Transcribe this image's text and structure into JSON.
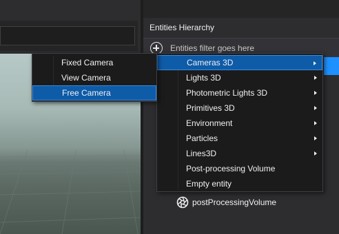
{
  "viewport_panel": {},
  "hierarchy": {
    "title": "Entities Hierarchy",
    "filter_placeholder": "Entities filter goes here",
    "add_icon": "plus-circle-icon",
    "items": [
      {
        "label": "postProcessingVolume",
        "icon": "aperture-icon"
      }
    ]
  },
  "context_menu": {
    "items": [
      {
        "label": "Cameras 3D",
        "has_submenu": true,
        "active": true
      },
      {
        "label": "Lights 3D",
        "has_submenu": true
      },
      {
        "label": "Photometric Lights 3D",
        "has_submenu": true
      },
      {
        "label": "Primitives 3D",
        "has_submenu": true
      },
      {
        "label": "Environment",
        "has_submenu": true
      },
      {
        "label": "Particles",
        "has_submenu": true
      },
      {
        "label": "Lines3D",
        "has_submenu": true
      },
      {
        "label": "Post-processing Volume",
        "has_submenu": false
      },
      {
        "label": "Empty entity",
        "has_submenu": false
      }
    ]
  },
  "camera_submenu": {
    "items": [
      {
        "label": "Fixed Camera"
      },
      {
        "label": "View Camera"
      },
      {
        "label": "Free Camera",
        "active": true
      }
    ]
  },
  "colors": {
    "background": "#2d2d30",
    "menu_background": "#1b1b1c",
    "highlight": "#0e5ba8",
    "selection": "#1e90ff"
  }
}
